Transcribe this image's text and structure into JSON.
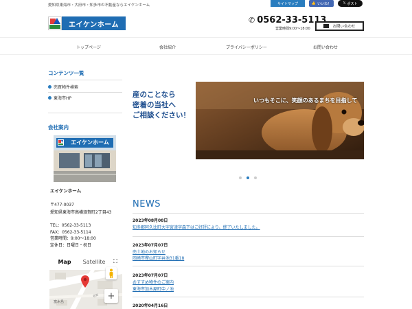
{
  "header": {
    "tagline": "愛知県東海市・大府市・知多市の不動産ならエイケンホーム",
    "sitemap_label": "サイトマップ",
    "like_label": "いいね！",
    "post_label": "ポスト",
    "logo_text": "エイケンホーム",
    "phone": "0562-33-5113",
    "hours": "営業時間9:00～18:00",
    "contact_label": "お問い合わせ"
  },
  "nav": {
    "items": [
      {
        "label": "トップページ"
      },
      {
        "label": "会社紹介"
      },
      {
        "label": "プライバシーポリシー"
      },
      {
        "label": "お問い合わせ"
      }
    ]
  },
  "sidebar": {
    "contents_heading": "コンテンツ一覧",
    "links": [
      {
        "label": "売買物件検索"
      },
      {
        "label": "東海市HP"
      }
    ],
    "company_heading": "会社案内",
    "photo_sign": "エイケンホーム",
    "company_name": "エイケンホーム",
    "postal": "〒477-0037",
    "address": "愛知県東海市高横須賀町2丁目43",
    "tel": "TEL：0562-33-5113",
    "fax": "FAX：0562-33-5114",
    "business_hours": "営業時間：9:00～18:00",
    "holiday": "定休日：日曜日・祝日",
    "map_tab": "Map",
    "satellite_tab": "Satellite"
  },
  "hero": {
    "left_text_1": "産のことなら",
    "left_text_2": "密着の当社へ",
    "left_text_3": "ご相談ください！",
    "right_text": "いつもそこに、笑顔のあるまちを目指して"
  },
  "news": {
    "title": "NEWS",
    "items": [
      {
        "date": "2023年08月08日",
        "text": "知多郡阿久比町大字宮津字森下はご好評により、終了いたしました。"
      },
      {
        "date": "2023年07月07日",
        "text": "売土地のお知らせ",
        "text2": "岡崎市樫山町字井池31番18"
      },
      {
        "date": "2023年07月07日",
        "text": "おすすめ物件のご案内",
        "text2": "東海市加木屋町中ノ池"
      },
      {
        "date": "2020年04月16日"
      }
    ]
  },
  "colors": {
    "accent": "#1f6db3",
    "facebook": "#4267b2",
    "x": "#111111"
  },
  "icons": [
    "phone-icon",
    "mail-icon",
    "thumbs-up-icon",
    "x-logo-icon",
    "bullet-dot-icon",
    "map-pin-icon",
    "fullscreen-icon",
    "pegman-icon",
    "zoom-in-icon"
  ]
}
